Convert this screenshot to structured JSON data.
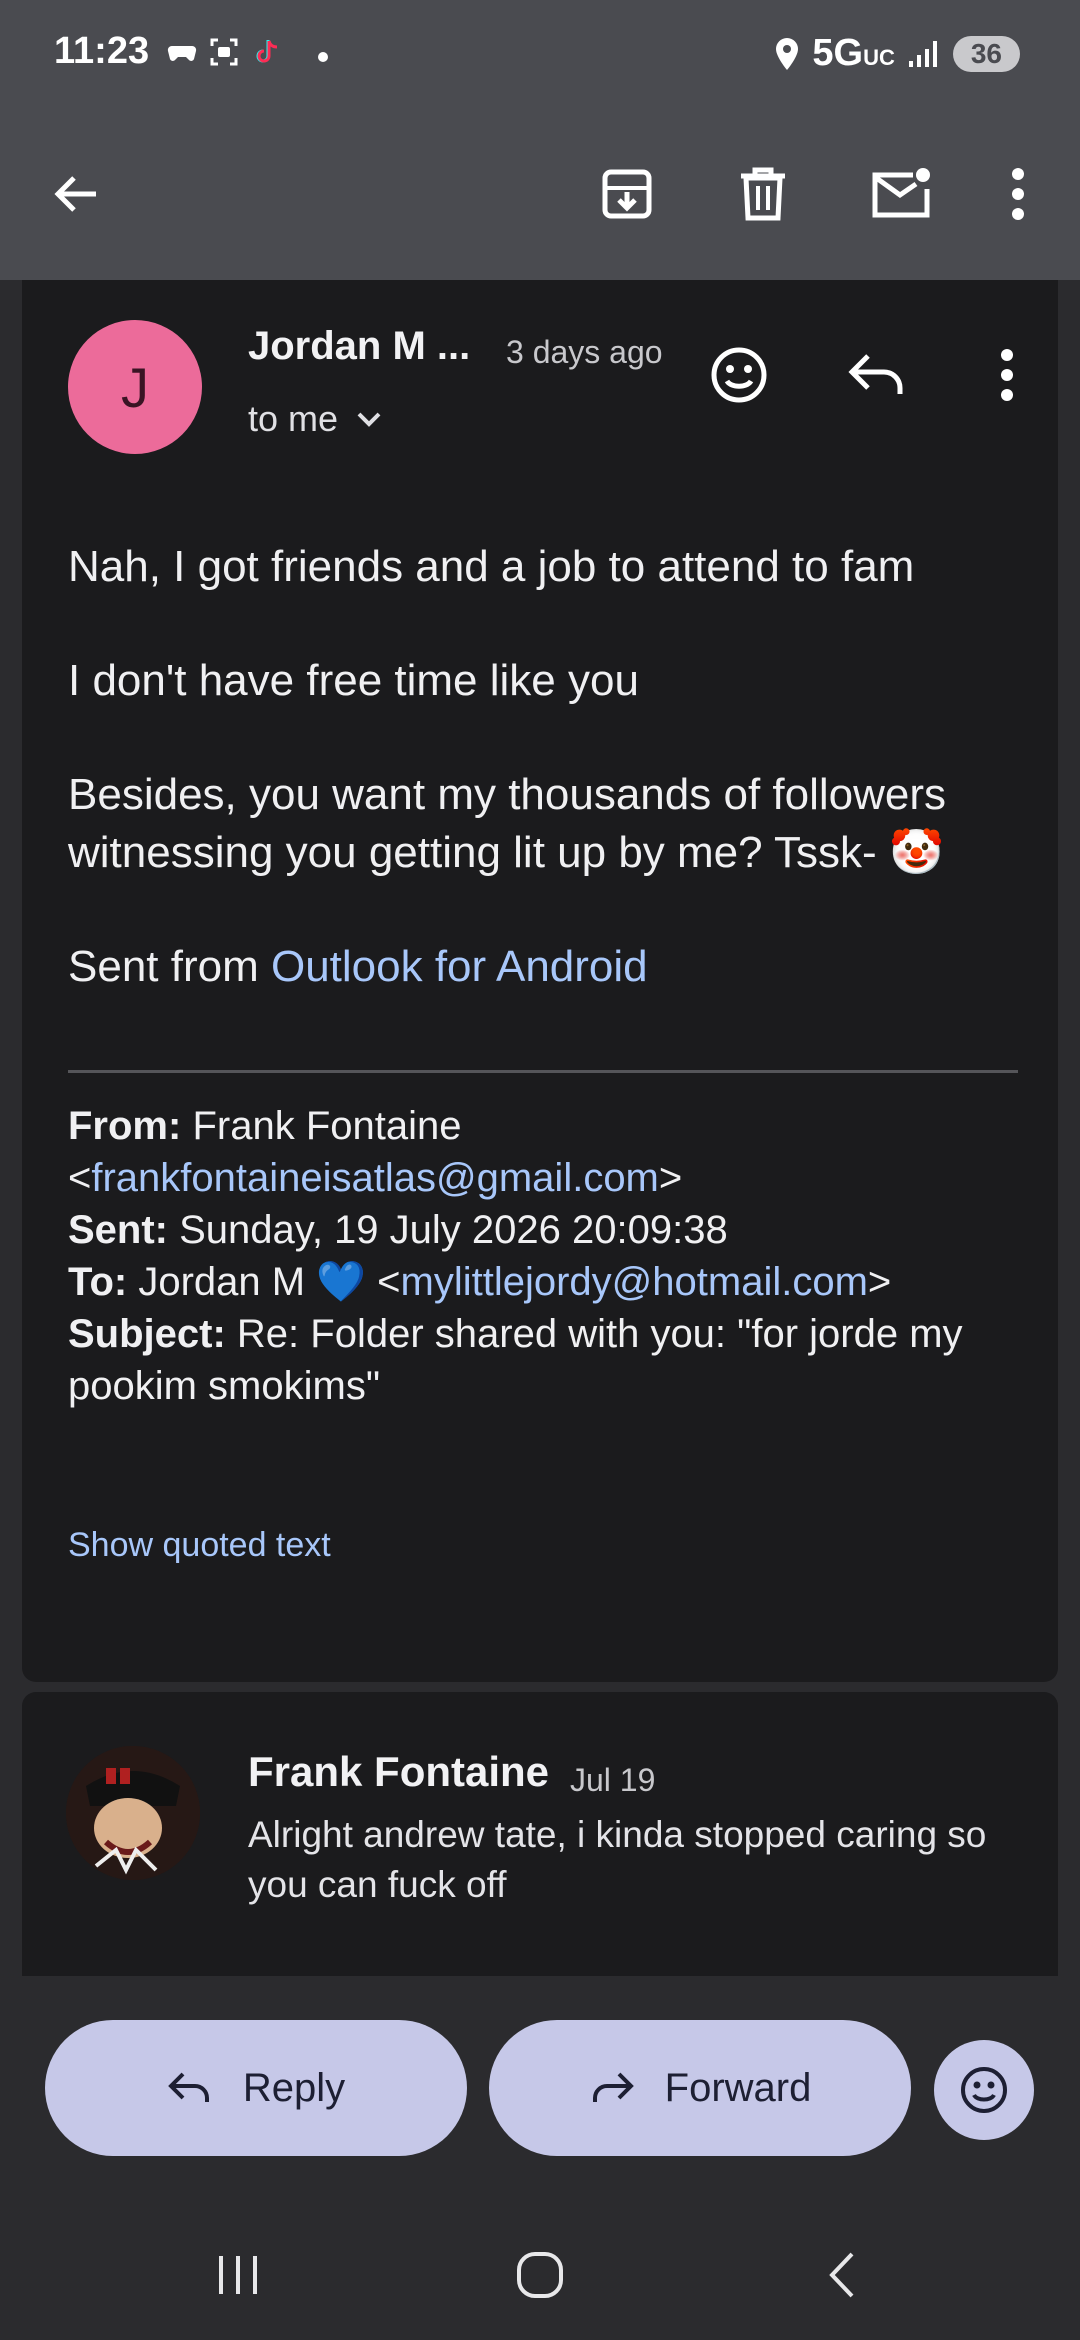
{
  "status_bar": {
    "time": "11:23",
    "network": "5G",
    "network_sub": "UC",
    "battery": "36",
    "app_icons": [
      "game-controller-icon",
      "screenshot-icon",
      "tiktok-icon"
    ]
  },
  "toolbar": {
    "icons": [
      "back-arrow-icon",
      "archive-icon",
      "delete-icon",
      "mark-unread-icon",
      "more-vert-icon"
    ]
  },
  "message": {
    "avatar_letter": "J",
    "sender": "Jordan M ...",
    "time": "3 days ago",
    "to_label": "to me",
    "body": {
      "p1": "Nah, I got friends and a job to attend to fam",
      "p2": "I don't have free time like you",
      "p3": "Besides, you want my thousands of followers witnessing you getting lit up by me? Tssk-",
      "p3_emoji": "🤡",
      "sent_from_prefix": "Sent from ",
      "sent_from_link": "Outlook for Android"
    },
    "quoted_header": {
      "from_label": "From:",
      "from_name": "Frank Fontaine",
      "from_email": "frankfontaineisatlas@gmail.com",
      "sent_label": "Sent:",
      "sent_value": "Sunday, 19 July 2026 20:09:38",
      "to_label": "To:",
      "to_name": "Jordan M",
      "to_emoji": "💙",
      "to_email": "mylittlejordy@hotmail.com",
      "subject_label": "Subject:",
      "subject_value": "Re: Folder shared with you: \"for jorde my pookim smokims\""
    },
    "show_quoted": "Show quoted text"
  },
  "previous_message": {
    "sender": "Frank Fontaine",
    "date": "Jul 19",
    "snippet": "Alright andrew tate, i kinda stopped caring so you can fuck off"
  },
  "actions": {
    "reply": "Reply",
    "forward": "Forward"
  },
  "colors": {
    "accent_link": "#a8c7fa",
    "button_fill": "#c6c8e8",
    "avatar_pink": "#ec6b9a"
  }
}
